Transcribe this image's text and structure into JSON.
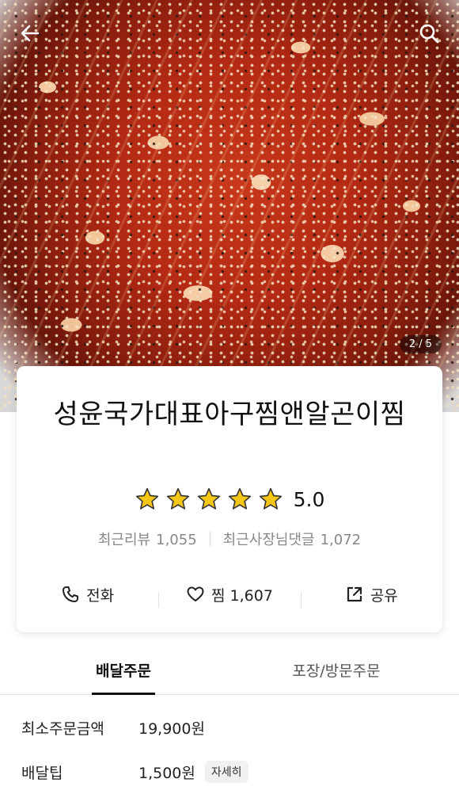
{
  "header": {
    "back_icon": "arrow-left-icon",
    "search_icon": "search-icon",
    "page_counter": "2 / 5"
  },
  "store": {
    "title": "성윤국가대표아구찜앤알곤이찜",
    "rating": "5.0",
    "rating_value": 5,
    "recent_reviews_label": "최근리뷰",
    "recent_reviews_count": "1,055",
    "owner_replies_label": "최근사장님댓글",
    "owner_replies_count": "1,072"
  },
  "actions": {
    "call_label": "전화",
    "favorite_label": "찜 1,607",
    "share_label": "공유"
  },
  "tabs": {
    "delivery": "배달주문",
    "pickup": "포장/방문주문"
  },
  "order_info": {
    "min_order_label": "최소주문금액",
    "min_order_value": "19,900원",
    "delivery_tip_label": "배달팁",
    "delivery_tip_value": "1,500원",
    "detail_button": "자세히"
  },
  "colors": {
    "star": "#f5c518",
    "star_stroke": "#333333",
    "active_tab_underline": "#111111"
  }
}
